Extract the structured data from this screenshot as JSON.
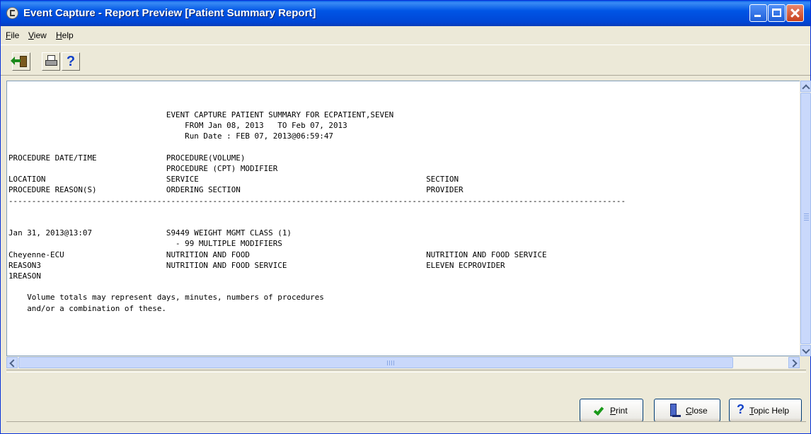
{
  "window": {
    "title": "Event Capture - Report Preview [Patient Summary Report]",
    "title_bar_color": "#0055e5"
  },
  "menu": {
    "items": [
      {
        "label_u": "F",
        "label_rest": "ile"
      },
      {
        "label_u": "V",
        "label_rest": "iew"
      },
      {
        "label_u": "H",
        "label_rest": "elp"
      }
    ]
  },
  "toolbar": {
    "icons": [
      "exit-icon",
      "printer-icon",
      "help-icon"
    ]
  },
  "report": {
    "lines": [
      "                                  EVENT CAPTURE PATIENT SUMMARY FOR ECPATIENT,SEVEN",
      "                                      FROM Jan 08, 2013   TO Feb 07, 2013",
      "                                      Run Date : FEB 07, 2013@06:59:47",
      "",
      "PROCEDURE DATE/TIME               PROCEDURE(VOLUME)",
      "                                  PROCEDURE (CPT) MODIFIER",
      "LOCATION                          SERVICE                                                 SECTION",
      "PROCEDURE REASON(S)               ORDERING SECTION                                        PROVIDER",
      "-------------------------------------------------------------------------------------------------------------------------------------",
      "",
      "",
      "Jan 31, 2013@13:07                S9449 WEIGHT MGMT CLASS (1)",
      "                                    - 99 MULTIPLE MODIFIERS",
      "Cheyenne-ECU                      NUTRITION AND FOOD                                      NUTRITION AND FOOD SERVICE",
      "REASON3                           NUTRITION AND FOOD SERVICE                              ELEVEN ECPROVIDER",
      "1REASON",
      "",
      "    Volume totals may represent days, minutes, numbers of procedures",
      "    and/or a combination of these."
    ]
  },
  "buttons": {
    "print": {
      "label_u": "P",
      "label_rest": "rint",
      "icon": "checkmark-icon"
    },
    "close": {
      "label_u": "C",
      "label_rest": "lose",
      "icon": "door-icon"
    },
    "topic_help": {
      "label_u": "T",
      "label_rest": "opic Help",
      "icon": "question-icon"
    }
  }
}
